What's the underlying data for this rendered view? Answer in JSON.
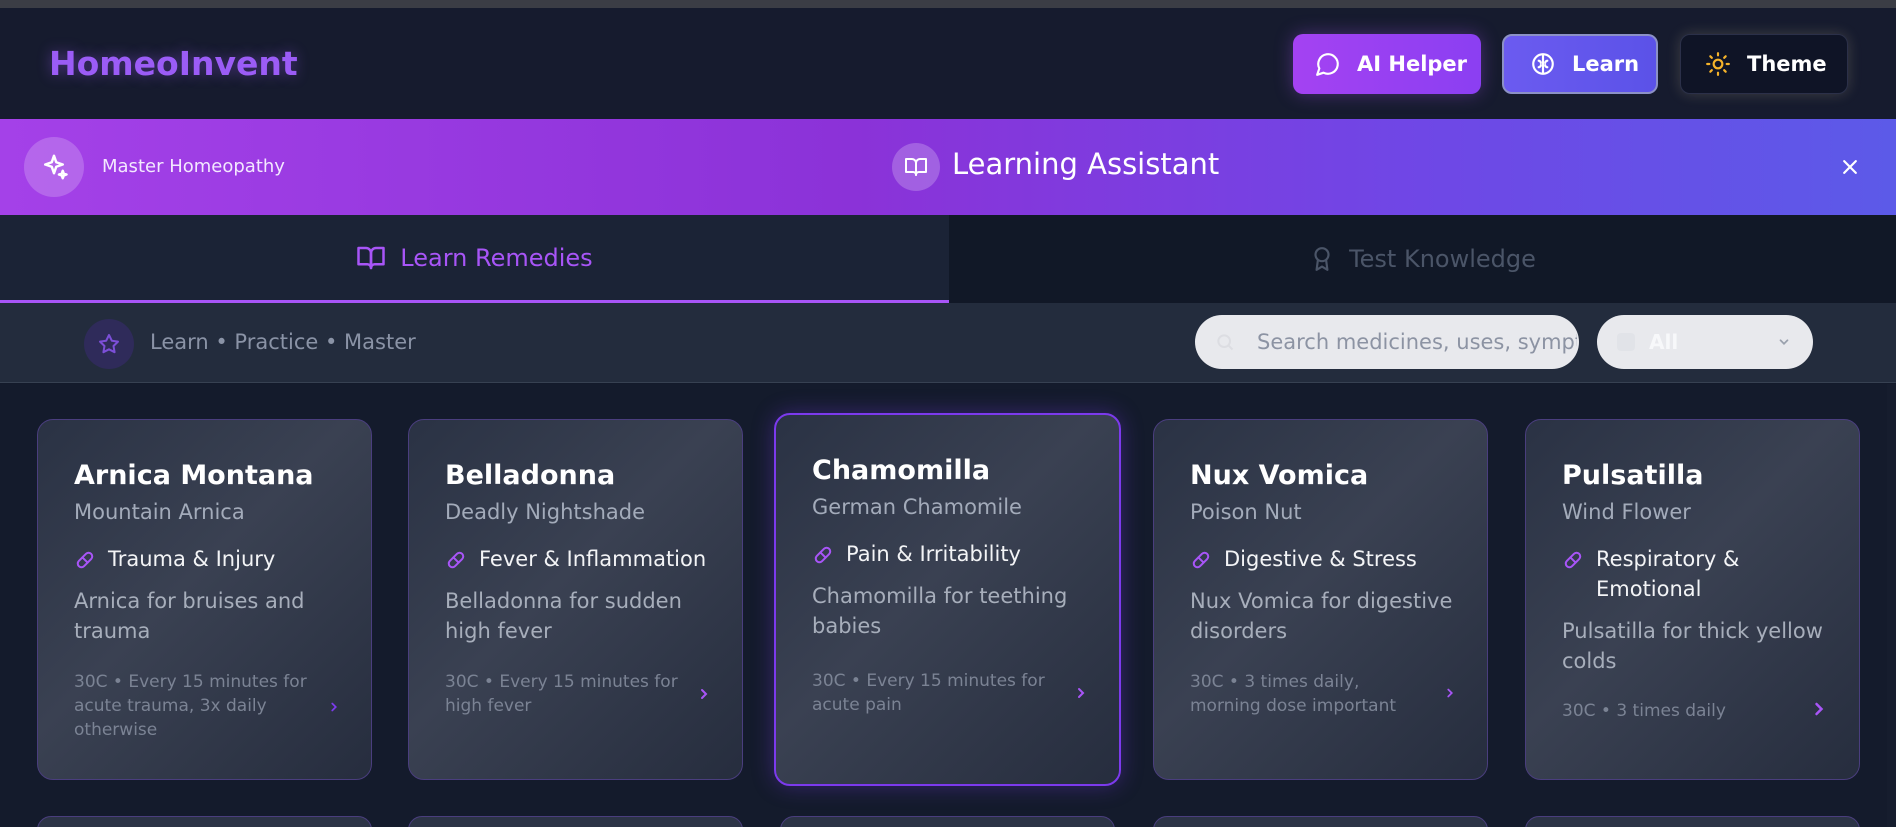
{
  "header": {
    "brand": "HomeoInvent",
    "ai_helper": "AI Helper",
    "learn": "Learn",
    "theme": "Theme"
  },
  "banner": {
    "tagline": "Master Homeopathy",
    "title": "Learning Assistant"
  },
  "tabs": [
    {
      "label": "Learn Remedies",
      "active": true
    },
    {
      "label": "Test Knowledge",
      "active": false
    }
  ],
  "toolbar": {
    "tagline": "Learn • Practice • Master",
    "search_placeholder": "Search medicines, uses, symptoms...",
    "filter_value": "All"
  },
  "cards": [
    {
      "name": "Arnica Montana",
      "common": "Mountain Arnica",
      "category": "Trauma & Injury",
      "description": "Arnica for bruises and trauma",
      "dosage": "30C • Every 15 minutes for acute trauma, 3x daily otherwise"
    },
    {
      "name": "Belladonna",
      "common": "Deadly Nightshade",
      "category": "Fever & Inflammation",
      "description": "Belladonna for sudden high fever",
      "dosage": "30C • Every 15 minutes for high fever"
    },
    {
      "name": "Chamomilla",
      "common": "German Chamomile",
      "category": "Pain & Irritability",
      "description": "Chamomilla for teething babies",
      "dosage": "30C • Every 15 minutes for acute pain"
    },
    {
      "name": "Nux Vomica",
      "common": "Poison Nut",
      "category": "Digestive & Stress",
      "description": "Nux Vomica for digestive disorders",
      "dosage": "30C • 3 times daily, morning dose important"
    },
    {
      "name": "Pulsatilla",
      "common": "Wind Flower",
      "category": "Respiratory & Emotional",
      "description": "Pulsatilla for thick yellow colds",
      "dosage": "30C • 3 times daily"
    }
  ],
  "colors": {
    "accent": "#a855f7",
    "background": "#131a2b",
    "banner_start": "#a441e8",
    "banner_end": "#5c5ae8"
  }
}
